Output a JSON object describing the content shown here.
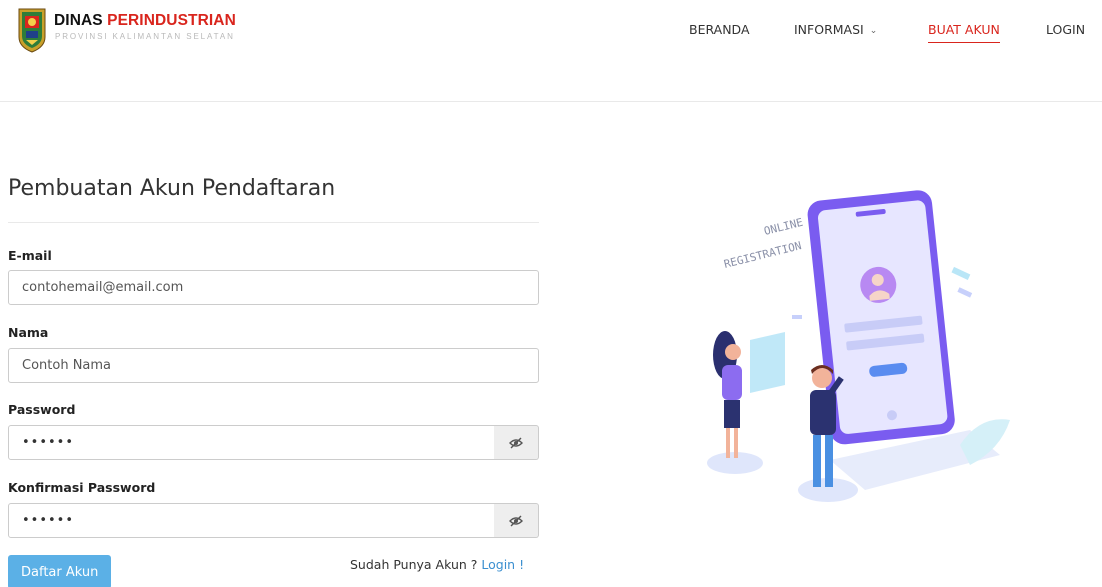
{
  "brand": {
    "title_part1": "DINAS ",
    "title_part2": "PERINDUSTRIAN",
    "subtitle": "PROVINSI KALIMANTAN SELATAN"
  },
  "nav": {
    "items": [
      {
        "label": "BERANDA"
      },
      {
        "label": "INFORMASI"
      },
      {
        "label": "BUAT AKUN",
        "active": true
      },
      {
        "label": "LOGIN"
      }
    ]
  },
  "form": {
    "title": "Pembuatan Akun Pendaftaran",
    "email": {
      "label": "E-mail",
      "value": "contohemail@email.com"
    },
    "nama": {
      "label": "Nama",
      "value": "Contoh Nama"
    },
    "password": {
      "label": "Password",
      "value": "••••••"
    },
    "konfirmasi": {
      "label": "Konfirmasi Password",
      "value": "••••••"
    },
    "submit_label": "Daftar Akun",
    "login_prompt": "Sudah Punya Akun ? ",
    "login_link": "Login !"
  },
  "illustration": {
    "caption_line1": "ONLINE",
    "caption_line2": "REGISTRATION"
  },
  "colors": {
    "accent_red": "#d9251d",
    "button_blue": "#5bb0e6",
    "link_blue": "#3b8fd0",
    "phone_purple": "#7a5cf0"
  },
  "icons": {
    "logo": "coat-of-arms-icon",
    "dropdown": "chevron-down-icon",
    "password_toggle": "eye-slash-icon"
  }
}
